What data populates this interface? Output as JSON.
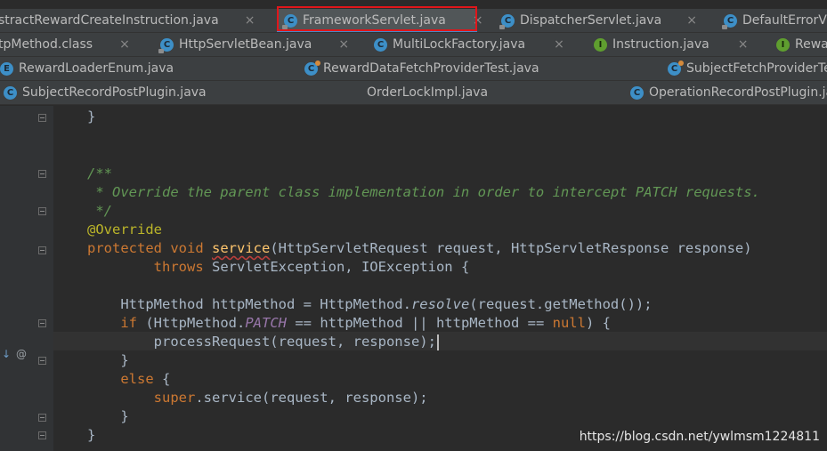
{
  "tabs": {
    "row1": [
      {
        "label": "stractRewardCreateInstruction.java",
        "icon": "",
        "close": "×"
      },
      {
        "label": "FrameworkServlet.java",
        "icon": "C",
        "close": "×"
      },
      {
        "label": "DispatcherServlet.java",
        "icon": "C",
        "close": "×"
      },
      {
        "label": "DefaultErrorVi",
        "icon": "C",
        "close": ""
      }
    ],
    "row2": [
      {
        "label": "tpMethod.class",
        "icon": "",
        "close": "×"
      },
      {
        "label": "HttpServletBean.java",
        "icon": "C",
        "close": "×"
      },
      {
        "label": "MultiLockFactory.java",
        "icon": "C",
        "close": "×"
      },
      {
        "label": "Instruction.java",
        "icon": "I",
        "close": "×"
      },
      {
        "label": "Rewa",
        "icon": "I",
        "close": ""
      }
    ],
    "row3": [
      {
        "label": "RewardLoaderEnum.java",
        "icon": "E",
        "close": ""
      },
      {
        "label": "RewardDataFetchProviderTest.java",
        "icon": "C",
        "close": ""
      },
      {
        "label": "SubjectFetchProviderTe",
        "icon": "C",
        "close": ""
      }
    ],
    "row4": [
      {
        "label": "SubjectRecordPostPlugin.java",
        "icon": "C",
        "close": ""
      },
      {
        "label": "OrderLockImpl.java",
        "icon": "",
        "close": ""
      },
      {
        "label": "OperationRecordPostPlugin.java",
        "icon": "C",
        "close": ""
      }
    ]
  },
  "gutter": {
    "override_marker": "↓",
    "annotation_marker": "@"
  },
  "code": {
    "l0": "}",
    "c1": "/**",
    "c2": " * Override the parent class implementation in order to intercept PATCH requests.",
    "c3": " */",
    "anno": "@Override",
    "kw_protected": "protected",
    "kw_void": "void",
    "m_name": "service",
    "sig_rest": "(HttpServletRequest request, HttpServletResponse response)",
    "kw_throws": "throws",
    "throws_rest": "ServletException, IOException {",
    "l8_a": "HttpMethod httpMethod = HttpMethod.",
    "l8_resolve": "resolve",
    "l8_b": "(request.getMethod());",
    "kw_if": "if",
    "l9_a": " (HttpMethod.",
    "l9_patch": "PATCH",
    "l9_b": " == httpMethod || httpMethod == ",
    "kw_null": "null",
    "l9_c": ") {",
    "l10": "processRequest(request, response);",
    "l11": "}",
    "kw_else": "else",
    "l12_b": " {",
    "kw_super": "super",
    "l13_b": ".service(request, response);",
    "l14": "}",
    "l15": "}"
  },
  "watermark": "https://blog.csdn.net/ywlmsm1224811",
  "colors": {
    "editor_bg": "#2b2b2b",
    "gutter_bg": "#313335",
    "tab_bg": "#3c3f41",
    "keyword": "#cc7832",
    "comment": "#629755",
    "annotation": "#bbb529",
    "method": "#ffc66d",
    "highlight_box": "#e0161b"
  }
}
